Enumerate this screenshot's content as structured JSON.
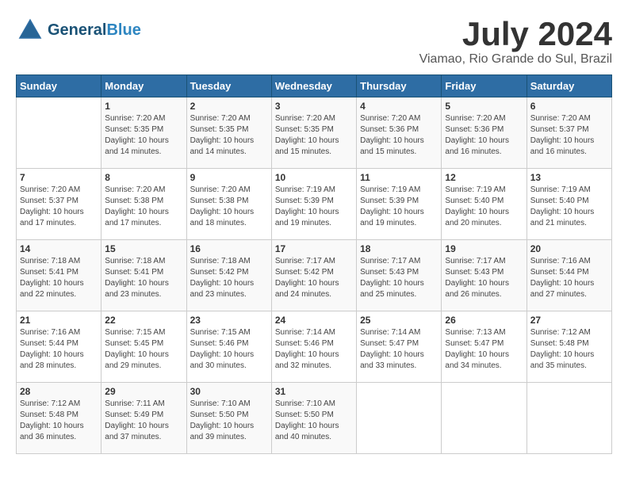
{
  "header": {
    "logo_line1": "General",
    "logo_line2": "Blue",
    "month_year": "July 2024",
    "location": "Viamao, Rio Grande do Sul, Brazil"
  },
  "weekdays": [
    "Sunday",
    "Monday",
    "Tuesday",
    "Wednesday",
    "Thursday",
    "Friday",
    "Saturday"
  ],
  "weeks": [
    [
      {
        "day": "",
        "info": ""
      },
      {
        "day": "1",
        "info": "Sunrise: 7:20 AM\nSunset: 5:35 PM\nDaylight: 10 hours\nand 14 minutes."
      },
      {
        "day": "2",
        "info": "Sunrise: 7:20 AM\nSunset: 5:35 PM\nDaylight: 10 hours\nand 14 minutes."
      },
      {
        "day": "3",
        "info": "Sunrise: 7:20 AM\nSunset: 5:35 PM\nDaylight: 10 hours\nand 15 minutes."
      },
      {
        "day": "4",
        "info": "Sunrise: 7:20 AM\nSunset: 5:36 PM\nDaylight: 10 hours\nand 15 minutes."
      },
      {
        "day": "5",
        "info": "Sunrise: 7:20 AM\nSunset: 5:36 PM\nDaylight: 10 hours\nand 16 minutes."
      },
      {
        "day": "6",
        "info": "Sunrise: 7:20 AM\nSunset: 5:37 PM\nDaylight: 10 hours\nand 16 minutes."
      }
    ],
    [
      {
        "day": "7",
        "info": "Sunrise: 7:20 AM\nSunset: 5:37 PM\nDaylight: 10 hours\nand 17 minutes."
      },
      {
        "day": "8",
        "info": "Sunrise: 7:20 AM\nSunset: 5:38 PM\nDaylight: 10 hours\nand 17 minutes."
      },
      {
        "day": "9",
        "info": "Sunrise: 7:20 AM\nSunset: 5:38 PM\nDaylight: 10 hours\nand 18 minutes."
      },
      {
        "day": "10",
        "info": "Sunrise: 7:19 AM\nSunset: 5:39 PM\nDaylight: 10 hours\nand 19 minutes."
      },
      {
        "day": "11",
        "info": "Sunrise: 7:19 AM\nSunset: 5:39 PM\nDaylight: 10 hours\nand 19 minutes."
      },
      {
        "day": "12",
        "info": "Sunrise: 7:19 AM\nSunset: 5:40 PM\nDaylight: 10 hours\nand 20 minutes."
      },
      {
        "day": "13",
        "info": "Sunrise: 7:19 AM\nSunset: 5:40 PM\nDaylight: 10 hours\nand 21 minutes."
      }
    ],
    [
      {
        "day": "14",
        "info": "Sunrise: 7:18 AM\nSunset: 5:41 PM\nDaylight: 10 hours\nand 22 minutes."
      },
      {
        "day": "15",
        "info": "Sunrise: 7:18 AM\nSunset: 5:41 PM\nDaylight: 10 hours\nand 23 minutes."
      },
      {
        "day": "16",
        "info": "Sunrise: 7:18 AM\nSunset: 5:42 PM\nDaylight: 10 hours\nand 23 minutes."
      },
      {
        "day": "17",
        "info": "Sunrise: 7:17 AM\nSunset: 5:42 PM\nDaylight: 10 hours\nand 24 minutes."
      },
      {
        "day": "18",
        "info": "Sunrise: 7:17 AM\nSunset: 5:43 PM\nDaylight: 10 hours\nand 25 minutes."
      },
      {
        "day": "19",
        "info": "Sunrise: 7:17 AM\nSunset: 5:43 PM\nDaylight: 10 hours\nand 26 minutes."
      },
      {
        "day": "20",
        "info": "Sunrise: 7:16 AM\nSunset: 5:44 PM\nDaylight: 10 hours\nand 27 minutes."
      }
    ],
    [
      {
        "day": "21",
        "info": "Sunrise: 7:16 AM\nSunset: 5:44 PM\nDaylight: 10 hours\nand 28 minutes."
      },
      {
        "day": "22",
        "info": "Sunrise: 7:15 AM\nSunset: 5:45 PM\nDaylight: 10 hours\nand 29 minutes."
      },
      {
        "day": "23",
        "info": "Sunrise: 7:15 AM\nSunset: 5:46 PM\nDaylight: 10 hours\nand 30 minutes."
      },
      {
        "day": "24",
        "info": "Sunrise: 7:14 AM\nSunset: 5:46 PM\nDaylight: 10 hours\nand 32 minutes."
      },
      {
        "day": "25",
        "info": "Sunrise: 7:14 AM\nSunset: 5:47 PM\nDaylight: 10 hours\nand 33 minutes."
      },
      {
        "day": "26",
        "info": "Sunrise: 7:13 AM\nSunset: 5:47 PM\nDaylight: 10 hours\nand 34 minutes."
      },
      {
        "day": "27",
        "info": "Sunrise: 7:12 AM\nSunset: 5:48 PM\nDaylight: 10 hours\nand 35 minutes."
      }
    ],
    [
      {
        "day": "28",
        "info": "Sunrise: 7:12 AM\nSunset: 5:48 PM\nDaylight: 10 hours\nand 36 minutes."
      },
      {
        "day": "29",
        "info": "Sunrise: 7:11 AM\nSunset: 5:49 PM\nDaylight: 10 hours\nand 37 minutes."
      },
      {
        "day": "30",
        "info": "Sunrise: 7:10 AM\nSunset: 5:50 PM\nDaylight: 10 hours\nand 39 minutes."
      },
      {
        "day": "31",
        "info": "Sunrise: 7:10 AM\nSunset: 5:50 PM\nDaylight: 10 hours\nand 40 minutes."
      },
      {
        "day": "",
        "info": ""
      },
      {
        "day": "",
        "info": ""
      },
      {
        "day": "",
        "info": ""
      }
    ]
  ]
}
